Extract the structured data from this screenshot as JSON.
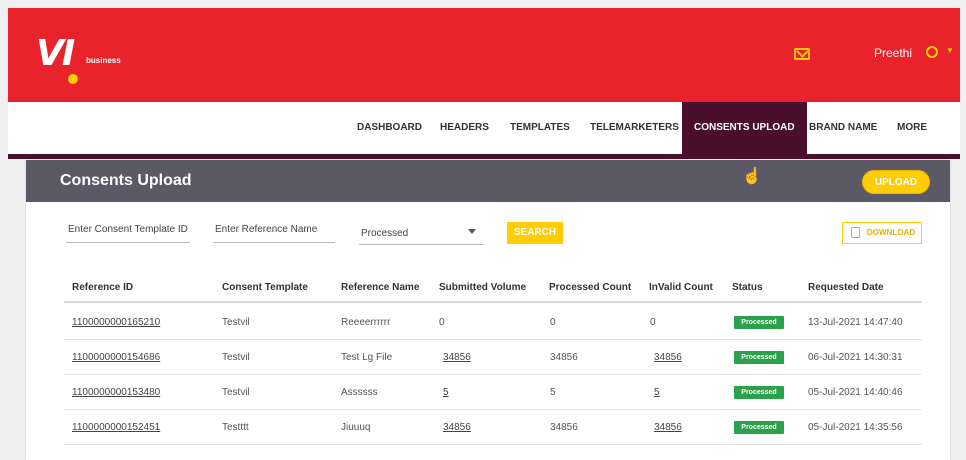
{
  "brand": {
    "logo_text": "VI",
    "sub": "business"
  },
  "user": {
    "name": "Preethi"
  },
  "nav": [
    "DASHBOARD",
    "HEADERS",
    "TEMPLATES",
    "TELEMARKETERS",
    "CONSENTS UPLOAD",
    "BRAND NAME",
    "MORE"
  ],
  "page": {
    "title": "Consents Upload",
    "upload_label": "UPLOAD"
  },
  "filters": {
    "template_id_placeholder": "Enter Consent Template ID",
    "reference_name_placeholder": "Enter Reference Name",
    "status_value": "Processed",
    "search_label": "SEARCH",
    "download_label": "DOWNLOAD"
  },
  "table": {
    "headers": [
      "Reference ID",
      "Consent Template",
      "Reference Name",
      "Submitted Volume",
      "Processed Count",
      "InValid Count",
      "Status",
      "Requested Date"
    ],
    "rows": [
      [
        "1100000000165210",
        "Testvil",
        "Reeeerrrrrr",
        "0",
        "0",
        "0",
        "Processed",
        "13-Jul-2021 14:47:40"
      ],
      [
        "1100000000154686",
        "Testvil",
        "Test Lg File",
        "34856",
        "34856",
        "34856",
        "Processed",
        "06-Jul-2021 14:30:31"
      ],
      [
        "1100000000153480",
        "Testvil",
        "Assssss",
        "5",
        "5",
        "5",
        "Processed",
        "05-Jul-2021 14:40:46"
      ],
      [
        "1100000000152451",
        "Testttt",
        "Jiuuuq",
        "34856",
        "34856",
        "34856",
        "Processed",
        "05-Jul-2021 14:35:56"
      ]
    ]
  },
  "colors": {
    "brand_red": "#e8232b",
    "accent_yellow": "#ffcd00",
    "nav_active": "#4a0f2d",
    "status_green": "#2aa14a"
  }
}
